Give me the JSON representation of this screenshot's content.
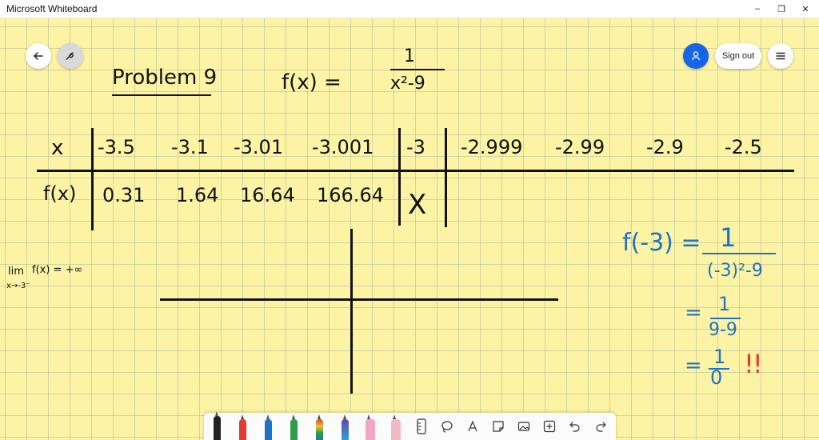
{
  "window": {
    "title": "Microsoft Whiteboard",
    "controls": [
      "–",
      "❐",
      "✕"
    ]
  },
  "header": {
    "sign_out_label": "Sign out"
  },
  "whiteboard": {
    "problem_title": "Problem 9",
    "function_lhs": "f(x) =",
    "function_numerator": "1",
    "function_denominator": "x²-9",
    "table": {
      "x_label": "x",
      "fx_label": "f(x)",
      "x_values": [
        "-3.5",
        "-3.1",
        "-3.01",
        "-3.001",
        "-3",
        "-2.999",
        "-2.99",
        "-2.9",
        "-2.5"
      ],
      "fx_values": [
        "0.31",
        "1.64",
        "16.64",
        "166.64",
        "X"
      ]
    },
    "limit_note": {
      "lim": "lim",
      "fx": "f(x) = +∞",
      "sub": "x→-3⁻"
    },
    "side_work": {
      "lhs": "f(-3) =",
      "n1": "1",
      "d1": "(-3)²-9",
      "eq2": "=",
      "n2": "1",
      "d2": "9-9",
      "eq3": "=",
      "n3": "1",
      "d3": "0",
      "mark": "!!"
    }
  },
  "colors": {
    "paper": "#fcf3a5",
    "ink": "#111111",
    "blue_ink": "#1f72c4",
    "red_ink": "#e33b2f",
    "accent": "#1565e6"
  },
  "toolbar": {
    "tools": [
      "black-pen",
      "red-pen",
      "blue-pen",
      "green-pen",
      "rainbow-pen",
      "galaxy-pen",
      "highlighter",
      "eraser",
      "ruler",
      "lasso",
      "text",
      "note",
      "image",
      "add",
      "undo",
      "redo"
    ]
  }
}
